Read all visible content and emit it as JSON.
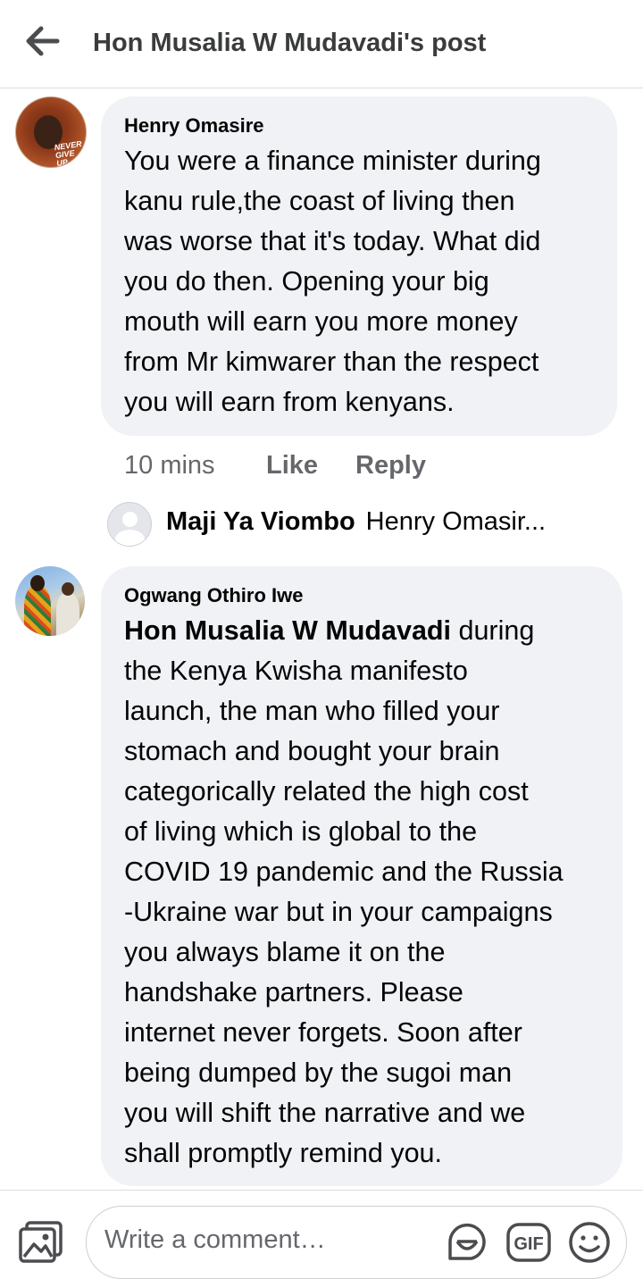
{
  "header": {
    "back_icon": "arrow-left-icon",
    "title": "Hon Musalia W Mudavadi's post"
  },
  "comments": [
    {
      "author": "Henry Omasire",
      "avatar_text": "NEVER GIVE UP",
      "text": "You were a finance minister during\nkanu rule,the coast of living then\nwas worse that it's today. What did\nyou do then. Opening your big\nmouth will earn you more money\nfrom Mr kimwarer than the respect\nyou will earn from kenyans.",
      "time": "10 mins",
      "like_label": "Like",
      "reply_label": "Reply",
      "reply_preview": {
        "author": "Maji Ya Viombo",
        "snippet": "Henry Omasir..."
      }
    },
    {
      "author": "Ogwang Othiro Iwe",
      "mention": "Hon Musalia W Mudavadi",
      "text": " during\nthe Kenya Kwisha manifesto\nlaunch, the man who filled your\nstomach and bought your brain\ncategorically related the high cost\nof living which is global to the\nCOVID 19 pandemic and the Russia\n-Ukraine war but in your campaigns\nyou always blame it on the\nhandshake partners. Please\ninternet never forgets.  Soon after\nbeing dumped by the sugoi man\nyou will shift the narrative and we\nshall promptly remind you."
    }
  ],
  "composer": {
    "placeholder": "Write a comment…",
    "photo_icon": "photo-icon",
    "sticker_icon": "sticker-icon",
    "gif_label": "GIF",
    "emoji_icon": "emoji-icon"
  },
  "colors": {
    "bubble_bg": "#f0f2f5",
    "secondary_text": "#65676b",
    "divider": "#dadde1"
  }
}
